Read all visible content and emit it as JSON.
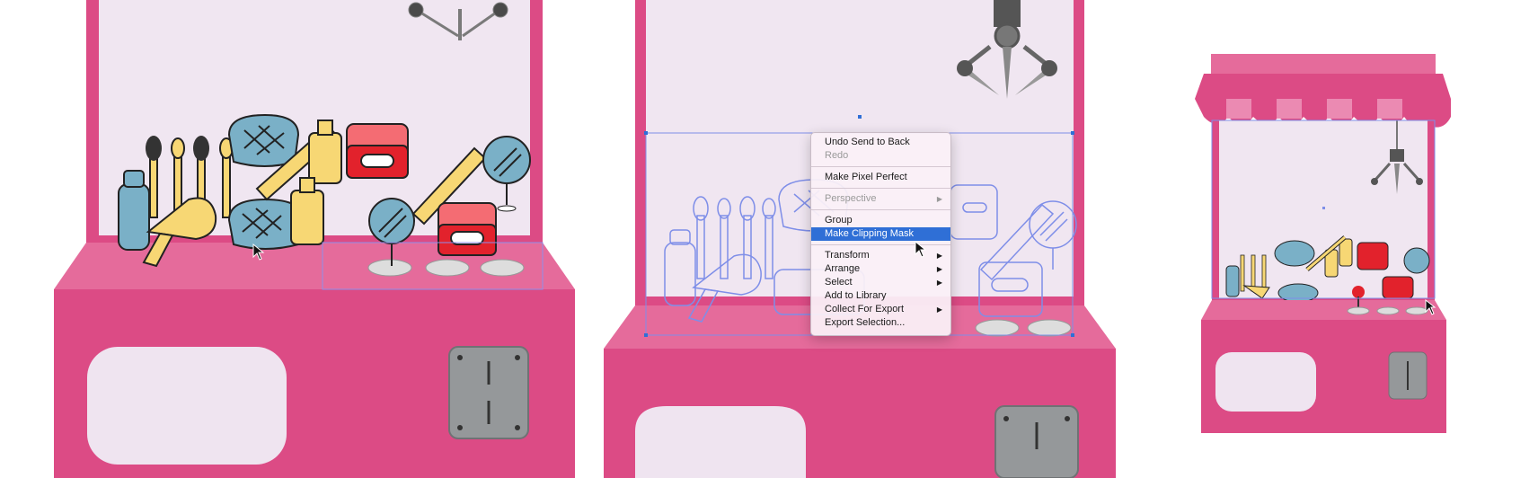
{
  "colors": {
    "machine_pink": "#dc4b85",
    "machine_top": "#e56b9b",
    "glass": "#f0e6f1",
    "window": "#efe4f0",
    "coin_slot": "#95989a",
    "accent_blue": "#2f6fd6",
    "selection_outline": "#7e8ee8"
  },
  "context_menu": {
    "items": [
      {
        "label": "Undo Send to Back",
        "enabled": true,
        "submenu": false
      },
      {
        "label": "Redo",
        "enabled": false,
        "submenu": false
      },
      {
        "separator": true
      },
      {
        "label": "Make Pixel Perfect",
        "enabled": true,
        "submenu": false
      },
      {
        "separator": true
      },
      {
        "label": "Perspective",
        "enabled": false,
        "submenu": true
      },
      {
        "separator": true
      },
      {
        "label": "Group",
        "enabled": true,
        "submenu": false
      },
      {
        "label": "Make Clipping Mask",
        "enabled": true,
        "submenu": false,
        "highlighted": true
      },
      {
        "separator": true
      },
      {
        "label": "Transform",
        "enabled": true,
        "submenu": true
      },
      {
        "label": "Arrange",
        "enabled": true,
        "submenu": true
      },
      {
        "label": "Select",
        "enabled": true,
        "submenu": true
      },
      {
        "label": "Add to Library",
        "enabled": true,
        "submenu": false
      },
      {
        "label": "Collect For Export",
        "enabled": true,
        "submenu": true
      },
      {
        "label": "Export Selection...",
        "enabled": true,
        "submenu": false
      }
    ],
    "submenu_glyph": "▶"
  },
  "icons": [
    "claw-icon",
    "mascara-brush-icon",
    "cosmetic-bag-icon",
    "comb-icon",
    "lotion-bottle-icon",
    "hair-dryer-icon",
    "hand-mirror-icon",
    "nail-lamp-icon",
    "coin-slot-icon",
    "mouse-pointer-icon"
  ]
}
